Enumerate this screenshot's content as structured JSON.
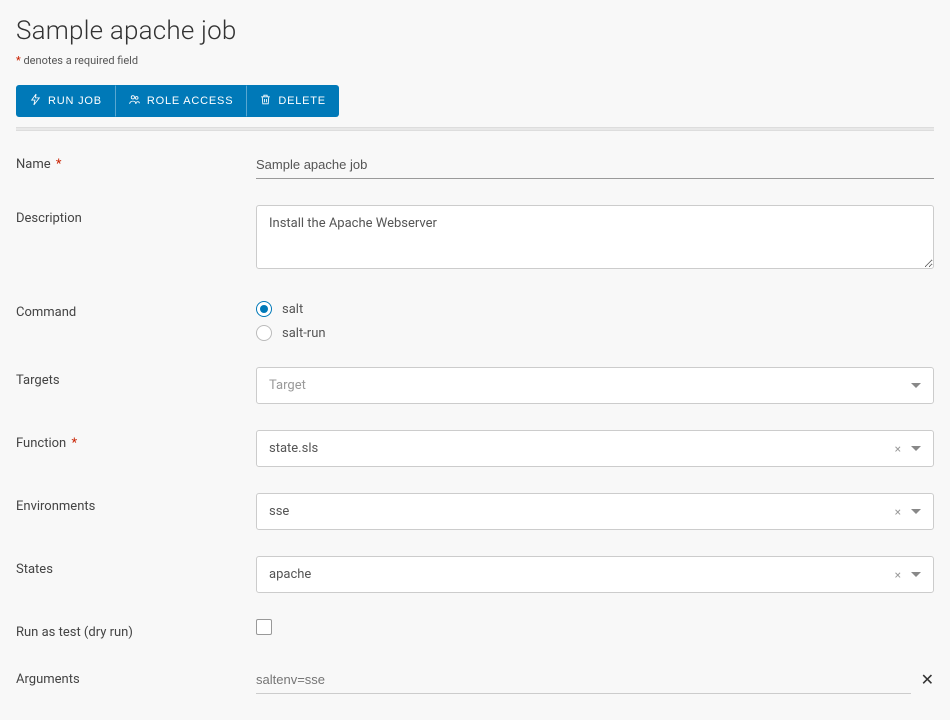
{
  "page": {
    "title": "Sample apache job",
    "required_note_pre": "*",
    "required_note_text": " denotes a required field"
  },
  "toolbar": {
    "run": "RUN JOB",
    "role_access": "ROLE ACCESS",
    "delete": "DELETE"
  },
  "labels": {
    "name": "Name",
    "description": "Description",
    "command": "Command",
    "targets": "Targets",
    "function": "Function",
    "environments": "Environments",
    "states": "States",
    "run_test": "Run as test (dry run)",
    "arguments": "Arguments"
  },
  "values": {
    "name": "Sample apache job",
    "description": "Install the Apache Webserver",
    "command_selected": "salt",
    "command_options": {
      "salt": "salt",
      "salt_run": "salt-run"
    },
    "targets_placeholder": "Target",
    "function": "state.sls",
    "environments": "sse",
    "states": "apache",
    "arguments_placeholder": "saltenv=sse"
  }
}
